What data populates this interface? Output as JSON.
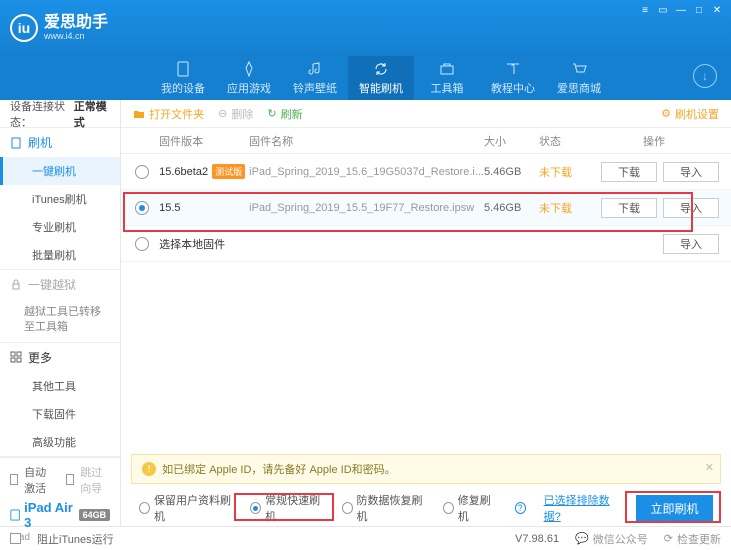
{
  "app": {
    "title": "爱思助手",
    "subtitle": "www.i4.cn"
  },
  "winControls": [
    "≡",
    "▭",
    "—",
    "□",
    "✕"
  ],
  "tabs": [
    {
      "label": "我的设备",
      "icon": "device"
    },
    {
      "label": "应用游戏",
      "icon": "apps"
    },
    {
      "label": "铃声壁纸",
      "icon": "music"
    },
    {
      "label": "智能刷机",
      "icon": "refresh",
      "active": true
    },
    {
      "label": "工具箱",
      "icon": "tools"
    },
    {
      "label": "教程中心",
      "icon": "book"
    },
    {
      "label": "爱思商城",
      "icon": "cart"
    }
  ],
  "sidebar": {
    "statusLabel": "设备连接状态：",
    "statusValue": "正常模式",
    "flashTitle": "刷机",
    "flashItems": [
      "一键刷机",
      "iTunes刷机",
      "专业刷机",
      "批量刷机"
    ],
    "jailbreakTitle": "一键越狱",
    "jailbreakNote": "越狱工具已转移至工具箱",
    "moreTitle": "更多",
    "moreItems": [
      "其他工具",
      "下载固件",
      "高级功能"
    ],
    "autoActivate": "自动激活",
    "skipGuide": "跳过向导",
    "deviceName": "iPad Air 3",
    "deviceStorage": "64GB",
    "deviceType": "iPad"
  },
  "toolbar": {
    "openFolder": "打开文件夹",
    "delete": "删除",
    "refresh": "刷新",
    "settings": "刷机设置"
  },
  "tableHead": {
    "ver": "固件版本",
    "name": "固件名称",
    "size": "大小",
    "status": "状态",
    "ops": "操作"
  },
  "rows": [
    {
      "ver": "15.6beta2",
      "tag": "测试版",
      "name": "iPad_Spring_2019_15.6_19G5037d_Restore.i...",
      "size": "5.46GB",
      "status": "未下载",
      "selected": false,
      "showDl": true
    },
    {
      "ver": "15.5",
      "name": "iPad_Spring_2019_15.5_19F77_Restore.ipsw",
      "size": "5.46GB",
      "status": "未下载",
      "selected": true,
      "showDl": true
    },
    {
      "ver": "选择本地固件",
      "local": true
    }
  ],
  "btns": {
    "download": "下载",
    "import": "导入"
  },
  "warning": "如已绑定 Apple ID，请先备好 Apple ID和密码。",
  "options": {
    "keepData": "保留用户资料刷机",
    "normal": "常规快速刷机",
    "antiRecovery": "防数据恢复刷机",
    "repair": "修复刷机",
    "excludeLink": "已选择排除数据?",
    "flashNow": "立即刷机"
  },
  "footer": {
    "blockItunes": "阻止iTunes运行",
    "version": "V7.98.61",
    "wechat": "微信公众号",
    "checkUpdate": "检查更新"
  }
}
